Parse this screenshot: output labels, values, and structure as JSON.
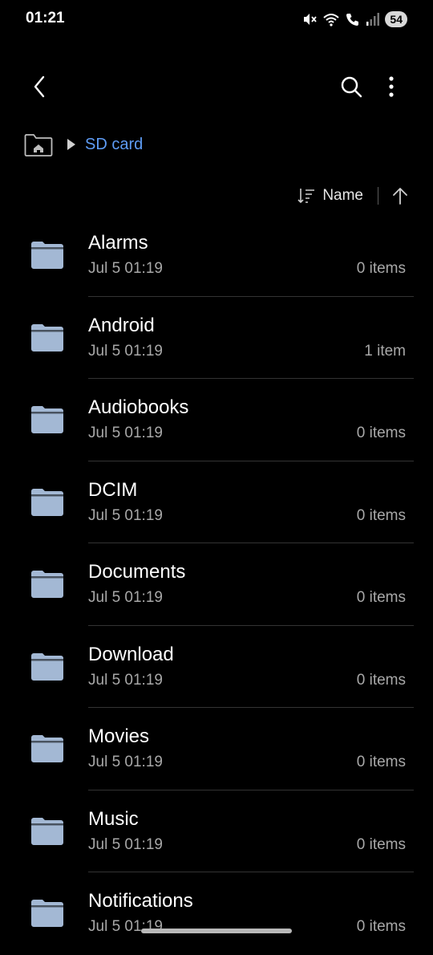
{
  "status_bar": {
    "time": "01:21",
    "battery": "54",
    "icons": [
      "mute-icon",
      "wifi-icon",
      "wifi-call-icon",
      "signal-icon"
    ]
  },
  "app_bar": {
    "icons": [
      "back-icon",
      "search-icon",
      "more-vert-icon"
    ]
  },
  "breadcrumb": {
    "home_icon": "home-folder-icon",
    "current": "SD card"
  },
  "sort": {
    "label": "Name",
    "icons": [
      "sort-icon",
      "arrow-up-icon"
    ]
  },
  "files": [
    {
      "name": "Alarms",
      "date": "Jul 5 01:19",
      "count": "0 items"
    },
    {
      "name": "Android",
      "date": "Jul 5 01:19",
      "count": "1 item"
    },
    {
      "name": "Audiobooks",
      "date": "Jul 5 01:19",
      "count": "0 items"
    },
    {
      "name": "DCIM",
      "date": "Jul 5 01:19",
      "count": "0 items"
    },
    {
      "name": "Documents",
      "date": "Jul 5 01:19",
      "count": "0 items"
    },
    {
      "name": "Download",
      "date": "Jul 5 01:19",
      "count": "0 items"
    },
    {
      "name": "Movies",
      "date": "Jul 5 01:19",
      "count": "0 items"
    },
    {
      "name": "Music",
      "date": "Jul 5 01:19",
      "count": "0 items"
    },
    {
      "name": "Notifications",
      "date": "Jul 5 01:19",
      "count": "0 items"
    }
  ],
  "colors": {
    "background": "#000000",
    "accent": "#5e9cf5",
    "folder": "#a3b8d4",
    "secondary_text": "#a8a8a8"
  }
}
